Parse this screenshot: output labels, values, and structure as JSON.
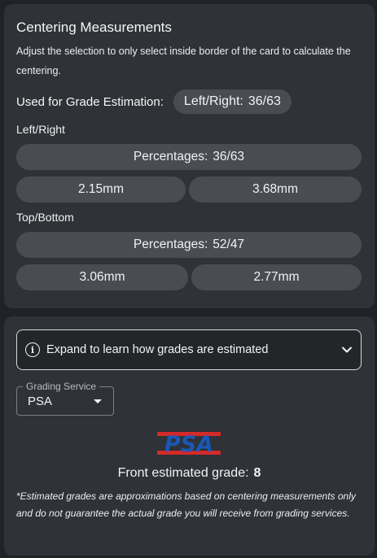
{
  "centering": {
    "title": "Centering Measurements",
    "subtitle": "Adjust the selection to only select inside border of the card to calculate the centering.",
    "grade_estimation_label": "Used for Grade Estimation:",
    "grade_estimation_key": "Left/Right:",
    "grade_estimation_value": "36/63",
    "left_right": {
      "label": "Left/Right",
      "percent_label": "Percentages:",
      "percent_value": "36/63",
      "left_mm": "2.15mm",
      "right_mm": "3.68mm"
    },
    "top_bottom": {
      "label": "Top/Bottom",
      "percent_label": "Percentages:",
      "percent_value": "52/47",
      "top_mm": "3.06mm",
      "bottom_mm": "2.77mm"
    }
  },
  "grading": {
    "expander_text": "Expand to learn how grades are estimated",
    "service_legend": "Grading Service",
    "service_value": "PSA",
    "logo_text": "PSA",
    "estimate_label": "Front estimated grade:",
    "estimate_value": "8",
    "disclaimer": "*Estimated grades are approximations based on centering measurements only and do not guarantee the actual grade you will receive from grading services."
  },
  "colors": {
    "page_bg": "#1f2226",
    "panel_bg": "#2f3236",
    "pill_bg": "#494c52",
    "psa_red": "#d42a2a",
    "psa_blue": "#1b57b6"
  },
  "icons": {
    "info": "info-icon",
    "chevron": "chevron-down-icon",
    "caret": "caret-down-icon"
  }
}
